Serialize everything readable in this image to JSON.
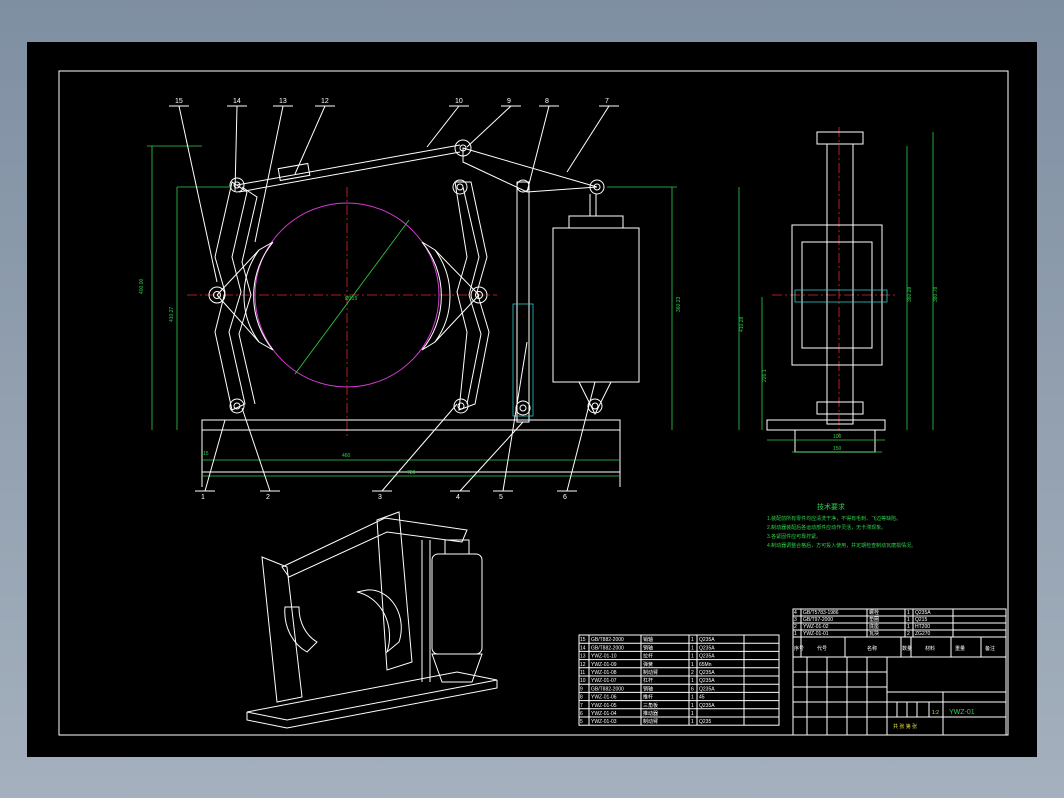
{
  "balloons": [
    "1",
    "2",
    "3",
    "4",
    "5",
    "6",
    "7",
    "8",
    "9",
    "10",
    "12",
    "13",
    "14",
    "15"
  ],
  "dims_front": {
    "d1": "460",
    "d2": "720",
    "d3": "15",
    "h1": "400.00",
    "h2": "410.27",
    "h3": "360.23",
    "dia": "Ø315"
  },
  "dims_side": {
    "h1": "410.28",
    "h2": "360.28",
    "h3": "380.78",
    "h4": "226.1",
    "w1": "50",
    "w2": "150",
    "w3": "100"
  },
  "tech": {
    "title": "技术要求",
    "lines": [
      "1.装配前所有零件均应清洗干净，不得有毛刺、飞边等缺陷。",
      "2.制动器装配后各运动部件应动作灵活，无卡滞现象。",
      "3.各紧固件应可靠拧紧。",
      "4.制动器调整合格后，方可投入使用，并定期检查制动瓦磨损情况。"
    ]
  },
  "parts_upper": [
    {
      "no": "4",
      "code": "GB/T5783-1986",
      "name": "螺栓",
      "qty": "1",
      "mat": "Q235A"
    },
    {
      "no": "3",
      "code": "GB/T97-2000",
      "name": "垫圈",
      "qty": "1",
      "mat": "Q215"
    },
    {
      "no": "2",
      "code": "YWZ-01-02",
      "name": "底座",
      "qty": "1",
      "mat": "HT200"
    },
    {
      "no": "1",
      "code": "YWZ-01-01",
      "name": "瓦块",
      "qty": "2",
      "mat": "ZG270"
    }
  ],
  "parts_left": [
    {
      "no": "15",
      "code": "GB/T882-2000",
      "name": "销轴",
      "qty": "1",
      "mat": "Q235A"
    },
    {
      "no": "14",
      "code": "GB/T882-2000",
      "name": "销轴",
      "qty": "1",
      "mat": "Q235A"
    },
    {
      "no": "13",
      "code": "YWZ-01-10",
      "name": "拉杆",
      "qty": "1",
      "mat": "Q235A"
    },
    {
      "no": "12",
      "code": "YWZ-01-09",
      "name": "弹簧",
      "qty": "1",
      "mat": "65Mn"
    },
    {
      "no": "11",
      "code": "YWZ-01-08",
      "name": "制动臂",
      "qty": "2",
      "mat": "Q235A"
    },
    {
      "no": "10",
      "code": "YWZ-01-07",
      "name": "杠杆",
      "qty": "1",
      "mat": "Q235A"
    },
    {
      "no": "9",
      "code": "GB/T882-2000",
      "name": "销轴",
      "qty": "6",
      "mat": "Q235A"
    },
    {
      "no": "8",
      "code": "YWZ-01-06",
      "name": "推杆",
      "qty": "1",
      "mat": "45"
    },
    {
      "no": "7",
      "code": "YWZ-01-05",
      "name": "三角板",
      "qty": "1",
      "mat": "Q235A"
    },
    {
      "no": "6",
      "code": "YWZ-01-04",
      "name": "推动器",
      "qty": "1",
      "mat": ""
    },
    {
      "no": "5",
      "code": "YWZ-01-03",
      "name": "制动臂",
      "qty": "1",
      "mat": "Q235"
    }
  ],
  "table_heads": {
    "no": "序号",
    "code": "代号",
    "name": "名称",
    "qty": "数量",
    "mat": "材料",
    "weight": "重量",
    "note": "备注"
  },
  "title_block": {
    "drawing_no": "YWZ-01",
    "scale": "1:2",
    "sheet": "共 张 第 张"
  },
  "colors": {
    "bg": "#000000",
    "line": "#ffffff",
    "center": "#e0282c",
    "circle": "#d43cd4",
    "text": "#2fd14a",
    "hatch": "#31c6c6"
  }
}
